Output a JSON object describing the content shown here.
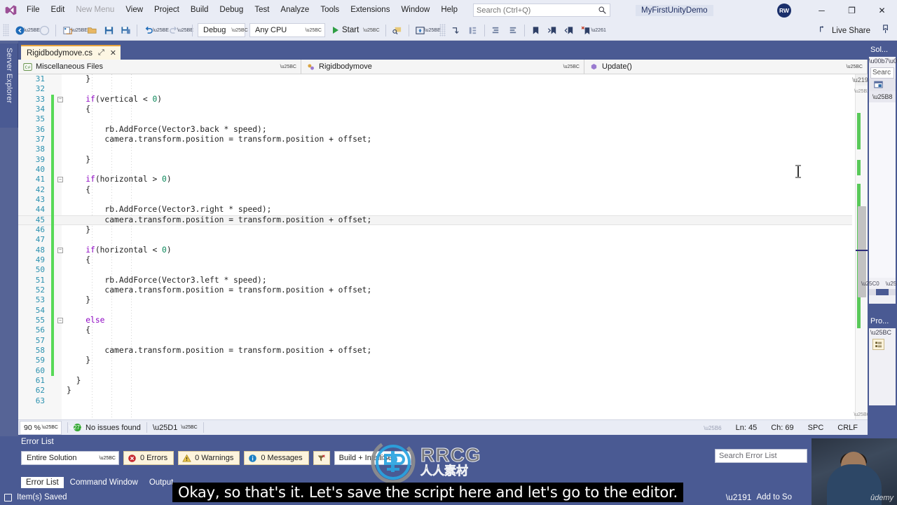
{
  "app": {
    "solution_name": "MyFirstUnityDemo",
    "avatar_initials": "RW"
  },
  "menu": {
    "items": [
      {
        "label": "File",
        "dim": false
      },
      {
        "label": "Edit",
        "dim": false
      },
      {
        "label": "New Menu",
        "dim": true
      },
      {
        "label": "View",
        "dim": false
      },
      {
        "label": "Project",
        "dim": false
      },
      {
        "label": "Build",
        "dim": false
      },
      {
        "label": "Debug",
        "dim": false
      },
      {
        "label": "Test",
        "dim": false
      },
      {
        "label": "Analyze",
        "dim": false
      },
      {
        "label": "Tools",
        "dim": false
      },
      {
        "label": "Extensions",
        "dim": false
      },
      {
        "label": "Window",
        "dim": false
      },
      {
        "label": "Help",
        "dim": false
      }
    ],
    "search_placeholder": "Search (Ctrl+Q)",
    "window_controls": {
      "minimize": "─",
      "restore": "❐",
      "close": "✕"
    }
  },
  "toolbar": {
    "config": "Debug",
    "platform": "Any CPU",
    "start_label": "Start",
    "live_share_label": "Live Share"
  },
  "editor": {
    "tab_title": "Rigidbodymove.cs",
    "tab_pin": "⤢",
    "tab_close": "✕",
    "nav_project": "Miscellaneous Files",
    "nav_class": "Rigidbodymove",
    "nav_member": "Update()",
    "zoom": "90 %",
    "issues": "No issues found",
    "line": "Ln: 45",
    "col": "Ch: 69",
    "spaces": "SPC",
    "eol": "CRLF",
    "lines": [
      {
        "n": 31,
        "text": "    }",
        "fold": "",
        "changed": false,
        "highlight": false
      },
      {
        "n": 32,
        "text": "",
        "fold": "",
        "changed": false,
        "highlight": false
      },
      {
        "n": 33,
        "text": "    if(vertical < 0)",
        "fold": "minus",
        "changed": true,
        "highlight": false
      },
      {
        "n": 34,
        "text": "    {",
        "fold": "",
        "changed": true,
        "highlight": false
      },
      {
        "n": 35,
        "text": "",
        "fold": "",
        "changed": true,
        "highlight": false
      },
      {
        "n": 36,
        "text": "        rb.AddForce(Vector3.back * speed);",
        "fold": "",
        "changed": true,
        "highlight": false
      },
      {
        "n": 37,
        "text": "        camera.transform.position = transform.position + offset;",
        "fold": "",
        "changed": true,
        "highlight": false
      },
      {
        "n": 38,
        "text": "",
        "fold": "",
        "changed": true,
        "highlight": false
      },
      {
        "n": 39,
        "text": "    }",
        "fold": "",
        "changed": true,
        "highlight": false
      },
      {
        "n": 40,
        "text": "",
        "fold": "",
        "changed": true,
        "highlight": false
      },
      {
        "n": 41,
        "text": "    if(horizontal > 0)",
        "fold": "minus",
        "changed": true,
        "highlight": false
      },
      {
        "n": 42,
        "text": "    {",
        "fold": "",
        "changed": true,
        "highlight": false
      },
      {
        "n": 43,
        "text": "",
        "fold": "",
        "changed": true,
        "highlight": false
      },
      {
        "n": 44,
        "text": "        rb.AddForce(Vector3.right * speed);",
        "fold": "",
        "changed": true,
        "highlight": false
      },
      {
        "n": 45,
        "text": "        camera.transform.position = transform.position + offset;",
        "fold": "",
        "changed": true,
        "highlight": true
      },
      {
        "n": 46,
        "text": "    }",
        "fold": "",
        "changed": true,
        "highlight": false
      },
      {
        "n": 47,
        "text": "",
        "fold": "",
        "changed": true,
        "highlight": false
      },
      {
        "n": 48,
        "text": "    if(horizontal < 0)",
        "fold": "minus",
        "changed": true,
        "highlight": false
      },
      {
        "n": 49,
        "text": "    {",
        "fold": "",
        "changed": true,
        "highlight": false
      },
      {
        "n": 50,
        "text": "",
        "fold": "",
        "changed": true,
        "highlight": false
      },
      {
        "n": 51,
        "text": "        rb.AddForce(Vector3.left * speed);",
        "fold": "",
        "changed": true,
        "highlight": false
      },
      {
        "n": 52,
        "text": "        camera.transform.position = transform.position + offset;",
        "fold": "",
        "changed": true,
        "highlight": false
      },
      {
        "n": 53,
        "text": "    }",
        "fold": "",
        "changed": true,
        "highlight": false
      },
      {
        "n": 54,
        "text": "",
        "fold": "",
        "changed": true,
        "highlight": false
      },
      {
        "n": 55,
        "text": "    else",
        "fold": "minus",
        "changed": true,
        "highlight": false
      },
      {
        "n": 56,
        "text": "    {",
        "fold": "",
        "changed": true,
        "highlight": false
      },
      {
        "n": 57,
        "text": "",
        "fold": "",
        "changed": true,
        "highlight": false
      },
      {
        "n": 58,
        "text": "        camera.transform.position = transform.position + offset;",
        "fold": "",
        "changed": true,
        "highlight": false
      },
      {
        "n": 59,
        "text": "    }",
        "fold": "",
        "changed": true,
        "highlight": false
      },
      {
        "n": 60,
        "text": "",
        "fold": "",
        "changed": true,
        "highlight": false
      },
      {
        "n": 61,
        "text": "  }",
        "fold": "",
        "changed": false,
        "highlight": false
      },
      {
        "n": 62,
        "text": "}",
        "fold": "",
        "changed": false,
        "highlight": false
      },
      {
        "n": 63,
        "text": "",
        "fold": "",
        "changed": false,
        "highlight": false
      }
    ]
  },
  "error_list": {
    "title": "Error List",
    "scope": "Entire Solution",
    "errors": "0 Errors",
    "warnings": "0 Warnings",
    "messages": "0 Messages",
    "build_filter": "Build + IntelliSe",
    "search_placeholder": "Search Error List",
    "tabs": [
      {
        "label": "Error List",
        "active": true
      },
      {
        "label": "Command Window",
        "active": false
      },
      {
        "label": "Output",
        "active": false
      }
    ]
  },
  "status_bar": {
    "saved_text": "Item(s) Saved",
    "source_control": "Add to So"
  },
  "left_rail": {
    "server_explorer": "Server Explorer"
  },
  "right_dock": {
    "solution_explorer": "Sol...",
    "search_placeholder": "Searc",
    "properties": "Pro..."
  },
  "overlay": {
    "subtitle": "Okay, so that's it. Let's save the script here and let's go to the editor.",
    "watermark_main": "RRCG",
    "watermark_cn": "人人素材",
    "webcam_brand": "ûdemy"
  },
  "colors": {
    "chrome": "#4a5a93",
    "toolbar_bg": "#e9ecf5",
    "tab_accent": "#e8a33d",
    "keyword": "#0000ff",
    "control_keyword": "#8f08c4",
    "line_number": "#2b91af",
    "changed_marker": "#57d957",
    "numeric": "#098658"
  }
}
